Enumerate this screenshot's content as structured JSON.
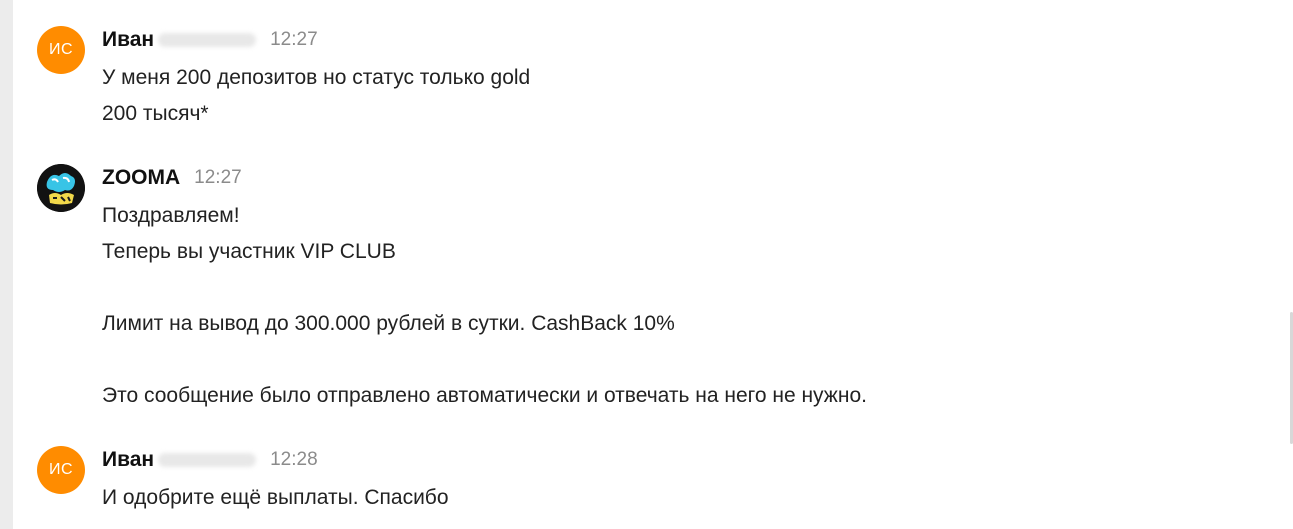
{
  "messages": [
    {
      "avatar": {
        "type": "initials",
        "text": "ИС",
        "color": "#ff8c00"
      },
      "author": "Иван",
      "time": "12:27",
      "lines": [
        "У меня 200 депозитов но статус только gold",
        "200 тысяч*"
      ]
    },
    {
      "avatar": {
        "type": "logo",
        "icon": "zooma-logo-icon"
      },
      "author": "ZOOMA",
      "time": "12:27",
      "lines": [
        "Поздравляем!",
        "Теперь вы участник VIP CLUB",
        "",
        "Лимит на вывод до 300.000 рублей в сутки. CashBack 10%",
        "",
        "Это сообщение было отправлено автоматически и отвечать на него не нужно."
      ]
    },
    {
      "avatar": {
        "type": "initials",
        "text": "ИС",
        "color": "#ff8c00"
      },
      "author": "Иван",
      "time": "12:28",
      "lines": [
        "И одобрите ещё выплаты. Спасибо"
      ]
    }
  ]
}
